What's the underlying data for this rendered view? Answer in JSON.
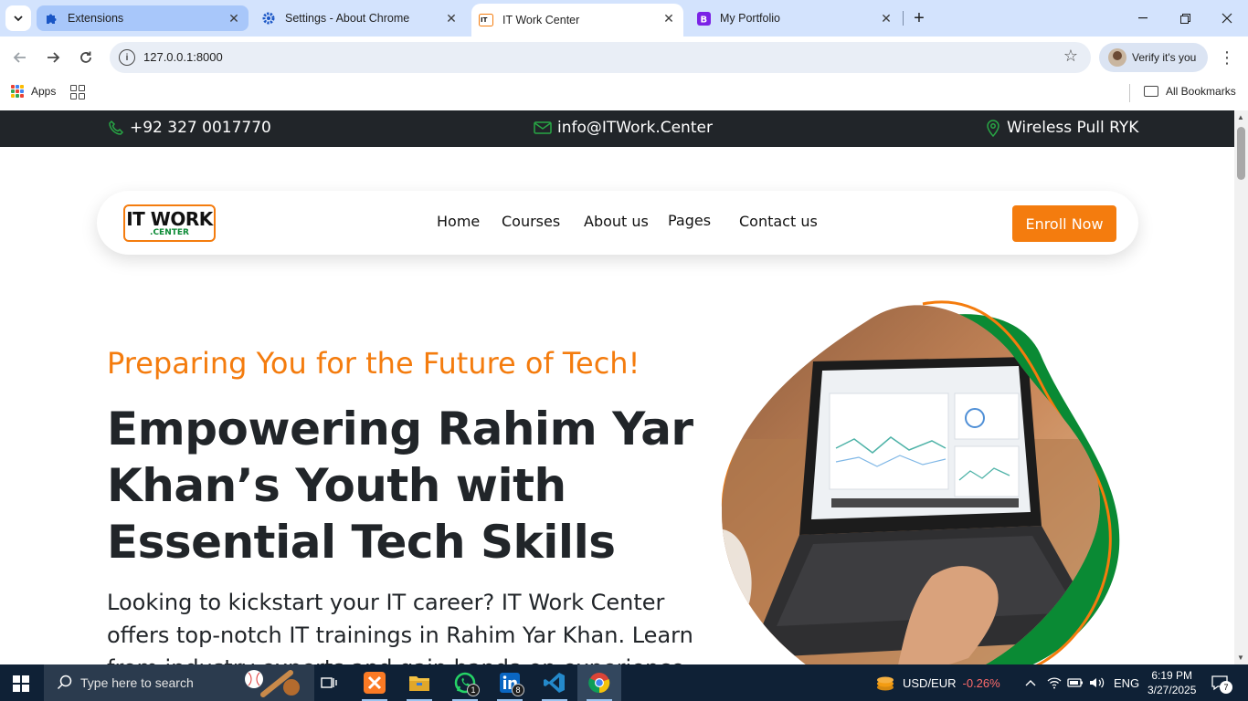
{
  "browser": {
    "tabs": [
      {
        "title": "Extensions",
        "icon": "puzzle-icon"
      },
      {
        "title": "Settings - About Chrome",
        "icon": "gear-icon"
      },
      {
        "title": "IT Work Center",
        "icon": "itwc-favicon",
        "active": true
      },
      {
        "title": "My Portfolio",
        "icon": "bootstrap-icon"
      }
    ],
    "url": "127.0.0.1:8000",
    "profile_label": "Verify it's you",
    "bookmarks": {
      "apps": "Apps",
      "all": "All Bookmarks"
    }
  },
  "site": {
    "topbar": {
      "phone": "+92 327 0017770",
      "email": "info@ITWork.Center",
      "location": "Wireless Pull RYK"
    },
    "logo": {
      "line1": "IT WORK",
      "line2": ".CENTER"
    },
    "nav": [
      "Home",
      "Courses",
      "About us",
      "Pages",
      "Contact us"
    ],
    "cta": "Enroll Now",
    "hero": {
      "tagline": "Preparing You for the Future of Tech!",
      "headline": "Empowering Rahim Yar Khan’s Youth with Essential Tech Skills",
      "description": "Looking to kickstart your IT career? IT Work Center offers top-notch IT trainings in Rahim Yar Khan. Learn from industry experts and gain hands-on experience"
    },
    "colors": {
      "accent": "#f47c0e",
      "green": "#0a8a34",
      "dark": "#212529"
    }
  },
  "taskbar": {
    "search_placeholder": "Type here to search",
    "ticker_label": "USD/EUR",
    "ticker_change": "-0.26%",
    "language": "ENG",
    "time": "6:19 PM",
    "date": "3/27/2025",
    "whatsapp_badge": "1",
    "linkedin_badge": "8",
    "notification_count": "7"
  }
}
